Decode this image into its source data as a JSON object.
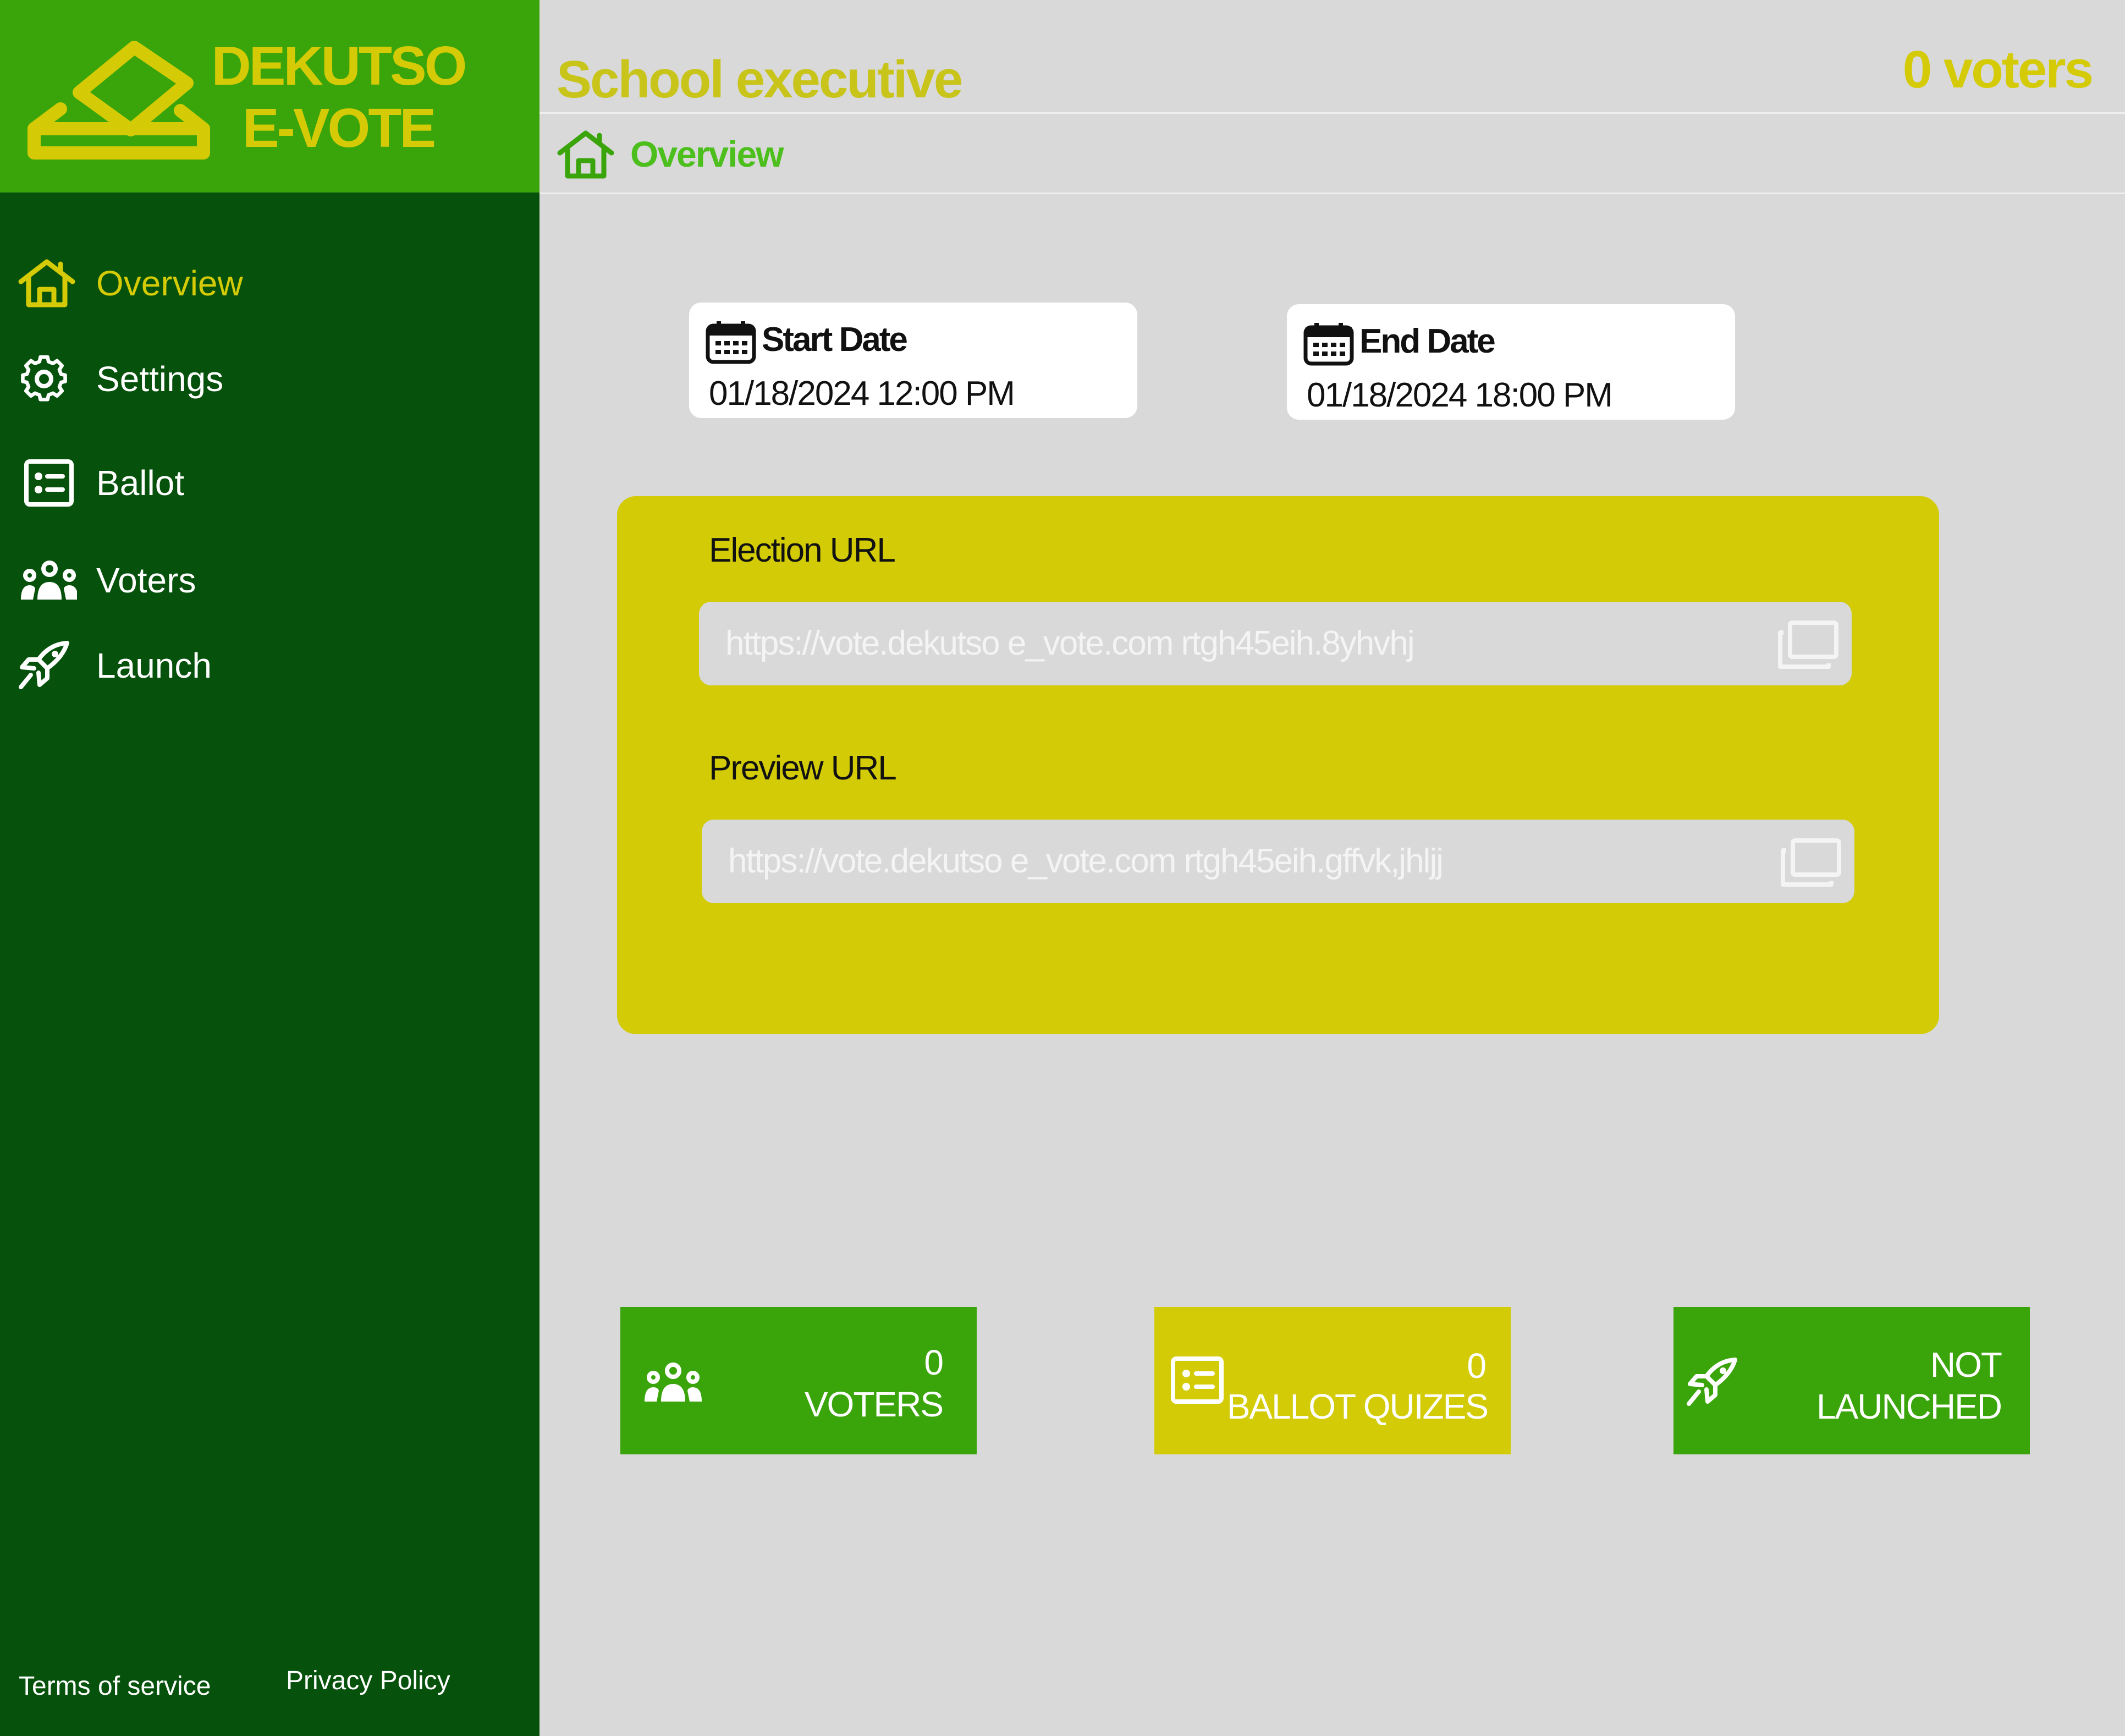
{
  "brand": {
    "line1": "DEKUTSO",
    "line2": "E-VOTE"
  },
  "sidebar": {
    "items": [
      {
        "label": "Overview",
        "icon": "home-icon",
        "active": true
      },
      {
        "label": "Settings",
        "icon": "gear-icon",
        "active": false
      },
      {
        "label": "Ballot",
        "icon": "ballot-list-icon",
        "active": false
      },
      {
        "label": "Voters",
        "icon": "users-icon",
        "active": false
      },
      {
        "label": "Launch",
        "icon": "rocket-icon",
        "active": false
      }
    ],
    "footer": {
      "terms": "Terms of service",
      "privacy": "Privacy Policy"
    }
  },
  "header": {
    "title": "School executive",
    "voter_count": "0 voters",
    "breadcrumb": "Overview"
  },
  "dates": {
    "start": {
      "title": "Start Date",
      "value": "01/18/2024 12:00 PM"
    },
    "end": {
      "title": "End Date",
      "value": "01/18/2024 18:00 PM"
    }
  },
  "urls": {
    "election": {
      "label": "Election URL",
      "value": "https://vote.dekutso e_vote.com rtgh45eih.8yhvhj"
    },
    "preview": {
      "label": "Preview URL",
      "value": "https://vote.dekutso e_vote.com rtgh45eih.gffvk,jhljj"
    }
  },
  "stats": {
    "voters": {
      "number": "0",
      "label": "VOTERS"
    },
    "ballot": {
      "number": "0",
      "label": "BALLOT QUIZES"
    },
    "launch": {
      "line1": "NOT",
      "line2": "LAUNCHED"
    }
  },
  "colors": {
    "sidebar_bg": "#06510b",
    "brand_bg": "#3aa40b",
    "accent_yellow": "#d4cb06",
    "accent_green": "#3aa40b",
    "page_bg": "#d9d9d9"
  }
}
